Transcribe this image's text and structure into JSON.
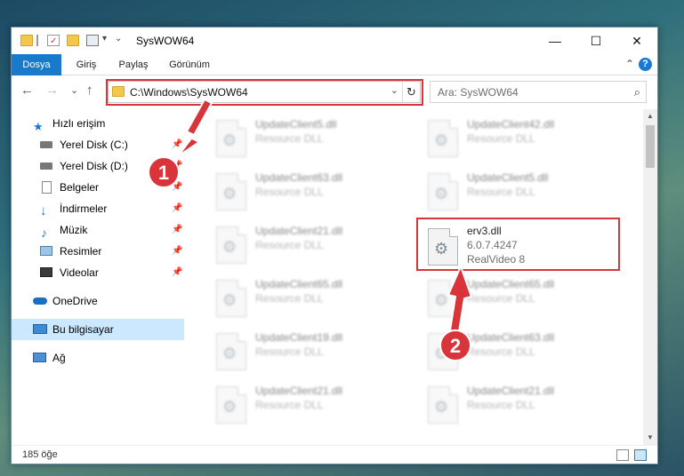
{
  "window": {
    "title": "SysWOW64",
    "controls": {
      "minimize": "—",
      "maximize": "☐",
      "close": "✕"
    }
  },
  "ribbon": {
    "tabs": [
      {
        "label": "Dosya",
        "active": true
      },
      {
        "label": "Giriş",
        "active": false
      },
      {
        "label": "Paylaş",
        "active": false
      },
      {
        "label": "Görünüm",
        "active": false
      }
    ],
    "collapse_icon": "chevron-up-icon",
    "help_icon": "?"
  },
  "nav": {
    "back": "←",
    "forward": "→",
    "recent": "⌄",
    "up": "↑",
    "address": "C:\\Windows\\SysWOW64",
    "address_dropdown": "⌄",
    "refresh": "↻",
    "search_placeholder": "Ara: SysWOW64",
    "search_icon": "⌕"
  },
  "sidebar": {
    "items": [
      {
        "label": "Hızlı erişim",
        "icon": "star-icon",
        "pinned": false
      },
      {
        "label": "Yerel Disk (C:)",
        "icon": "drive-icon",
        "pinned": true
      },
      {
        "label": "Yerel Disk (D:)",
        "icon": "drive-icon",
        "pinned": true
      },
      {
        "label": "Belgeler",
        "icon": "documents-icon",
        "pinned": true
      },
      {
        "label": "İndirmeler",
        "icon": "downloads-icon",
        "pinned": true
      },
      {
        "label": "Müzik",
        "icon": "music-icon",
        "pinned": true
      },
      {
        "label": "Resimler",
        "icon": "pictures-icon",
        "pinned": true
      },
      {
        "label": "Videolar",
        "icon": "videos-icon",
        "pinned": true
      },
      {
        "label": "OneDrive",
        "icon": "cloud-icon",
        "pinned": false
      },
      {
        "label": "Bu bilgisayar",
        "icon": "computer-icon",
        "pinned": false,
        "selected": true
      },
      {
        "label": "Ağ",
        "icon": "network-icon",
        "pinned": false
      }
    ],
    "pin_glyph": "📌"
  },
  "files": {
    "left": [
      {
        "name": "UpdateClient5.dll",
        "desc": "Resource DLL"
      },
      {
        "name": "UpdateClient63.dll",
        "desc": "Resource DLL"
      },
      {
        "name": "UpdateClient21.dll",
        "desc": "Resource DLL"
      },
      {
        "name": "UpdateClient65.dll",
        "desc": "Resource DLL"
      },
      {
        "name": "UpdateClient19.dll",
        "desc": "Resource DLL"
      },
      {
        "name": "UpdateClient21.dll",
        "desc": "Resource DLL"
      }
    ],
    "right": [
      {
        "name": "UpdateClient42.dll",
        "desc": "Resource DLL"
      },
      {
        "name": "UpdateClient5.dll",
        "desc": "Resource DLL"
      },
      {
        "name": "erv3.dll",
        "version": "6.0.7.4247",
        "desc": "RealVideo 8",
        "highlighted": true
      },
      {
        "name": "UpdateClient65.dll",
        "desc": "Resource DLL"
      },
      {
        "name": "UpdateClient63.dll",
        "desc": "Resource DLL"
      },
      {
        "name": "UpdateClient21.dll",
        "desc": "Resource DLL"
      }
    ]
  },
  "status": {
    "count": "185 öğe"
  },
  "markers": {
    "one": "1",
    "two": "2"
  },
  "colors": {
    "accent": "#1979ca",
    "highlight": "#d9343a",
    "selection": "#cce8ff"
  }
}
